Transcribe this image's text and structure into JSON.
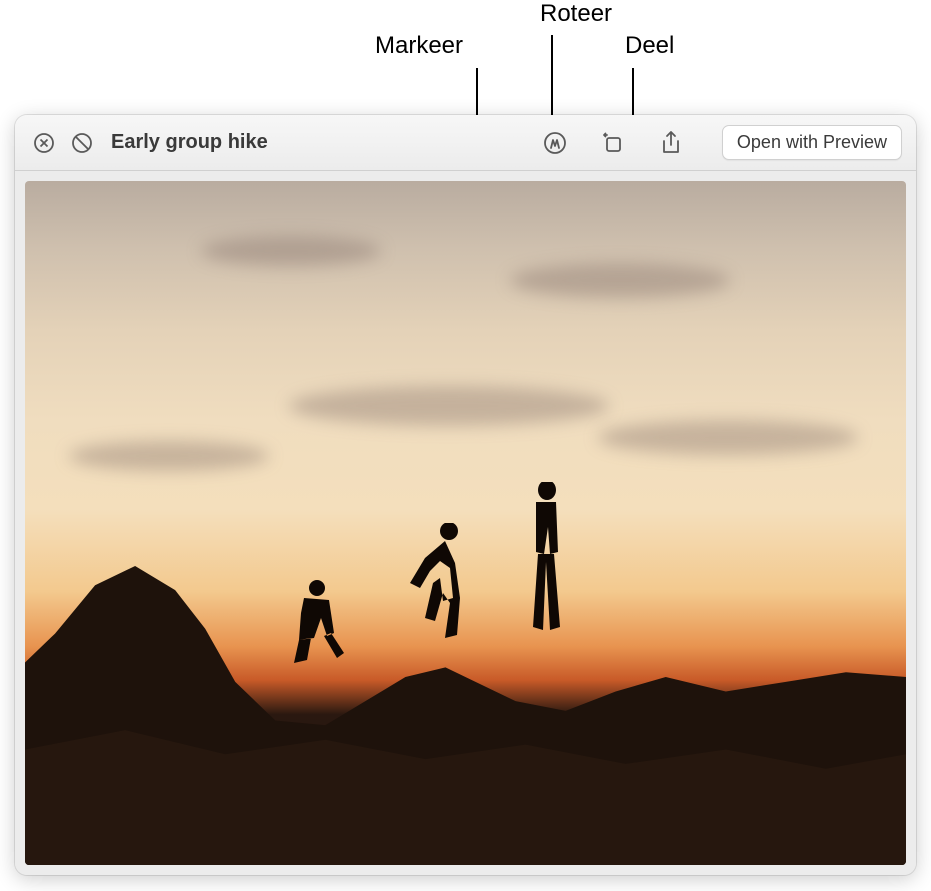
{
  "callouts": {
    "markup": "Markeer",
    "rotate": "Roteer",
    "share": "Deel"
  },
  "toolbar": {
    "title": "Early group hike",
    "open_label": "Open with Preview"
  },
  "icons": {
    "close": "close-icon",
    "no_entry": "no-entry-icon",
    "markup": "markup-icon",
    "rotate": "rotate-icon",
    "share": "share-icon"
  }
}
